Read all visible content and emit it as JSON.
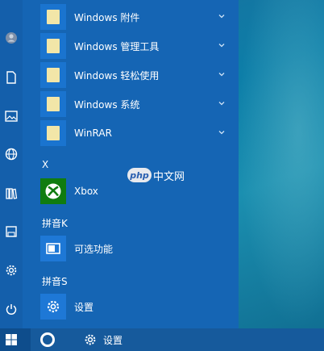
{
  "start_menu": {
    "items": [
      {
        "label": "Windows 附件",
        "icon": "folder-icon",
        "expandable": true
      },
      {
        "label": "Windows 管理工具",
        "icon": "folder-icon",
        "expandable": true
      },
      {
        "label": "Windows 轻松使用",
        "icon": "folder-icon",
        "expandable": true
      },
      {
        "label": "Windows 系统",
        "icon": "folder-icon",
        "expandable": true
      },
      {
        "label": "WinRAR",
        "icon": "folder-icon",
        "expandable": true
      }
    ],
    "section_x": "X",
    "xbox": {
      "label": "Xbox",
      "icon": "xbox-icon"
    },
    "section_k": "拼音K",
    "optional_features": {
      "label": "可选功能",
      "icon": "window-icon"
    },
    "section_s": "拼音S",
    "settings": {
      "label": "设置",
      "icon": "gear-icon"
    }
  },
  "rail": {
    "icons": [
      "user-icon",
      "document-icon",
      "pictures-icon",
      "globe-icon",
      "library-icon",
      "disk-icon",
      "gear-icon",
      "power-icon"
    ]
  },
  "watermark": {
    "badge": "php",
    "text": "中文网"
  },
  "taskbar": {
    "start_icon": "windows-logo-icon",
    "search_icon": "cortana-icon",
    "settings_label": "设置"
  },
  "colors": {
    "menu_bg": "#1565b4",
    "tile_blue": "#1e78d6",
    "xbox_green": "#107c10",
    "folder_yellow": "#f2e6a8",
    "taskbar_bg": "#0e4d8c"
  }
}
